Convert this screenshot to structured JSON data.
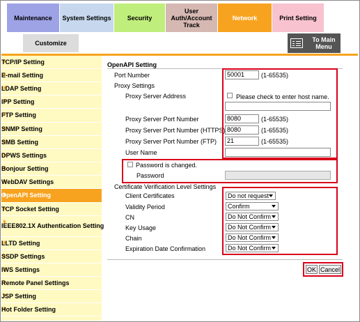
{
  "tabs": {
    "maintenance": "Maintenance",
    "system_settings": "System Settings",
    "security": "Security",
    "user_auth_line1": "User",
    "user_auth_line2": "Auth/Account",
    "user_auth_line3": "Track",
    "network": "Network",
    "print_setting": "Print Setting",
    "customize": "Customize",
    "to_main_line1": "To Main",
    "to_main_line2": "Menu"
  },
  "sidebar": {
    "items": [
      {
        "label": "TCP/IP Setting"
      },
      {
        "label": "E-mail Setting"
      },
      {
        "label": "LDAP Setting"
      },
      {
        "label": "IPP Setting"
      },
      {
        "label": "FTP Setting"
      },
      {
        "label": "SNMP Setting"
      },
      {
        "label": "SMB Setting"
      },
      {
        "label": "DPWS Settings"
      },
      {
        "label": "Bonjour Setting"
      },
      {
        "label": "WebDAV Settings"
      },
      {
        "label": "OpenAPI Setting"
      },
      {
        "label": "TCP Socket Setting"
      },
      {
        "label": "IEEE802.1X Authentication Setting"
      },
      {
        "label": "LLTD Setting"
      },
      {
        "label": "SSDP Settings"
      },
      {
        "label": "IWS Settings"
      },
      {
        "label": "Remote Panel Settings"
      },
      {
        "label": "JSP Setting"
      },
      {
        "label": "Hot Folder Setting"
      }
    ],
    "active": "OpenAPI Setting"
  },
  "form": {
    "title": "OpenAPI Setting",
    "port_number_label": "Port Number",
    "port_number_value": "50001",
    "port_number_range": "(1-65535)",
    "proxy_settings_label": "Proxy Settings",
    "proxy_address_label": "Proxy Server Address",
    "proxy_address_check_label": "Please check to enter host name.",
    "proxy_address_value": "",
    "proxy_port_label": "Proxy Server Port Number",
    "proxy_port_value": "8080",
    "proxy_port_range": "(1-65535)",
    "proxy_https_label": "Proxy Server Port Number (HTTPS)",
    "proxy_https_value": "8080",
    "proxy_https_range": "(1-65535)",
    "proxy_ftp_label": "Proxy Server Port Number (FTP)",
    "proxy_ftp_value": "21",
    "proxy_ftp_range": "(1-65535)",
    "user_name_label": "User Name",
    "user_name_value": "",
    "password_changed_label": "Password is changed.",
    "password_label": "Password",
    "cert_level_label": "Certificate Verification Level Settings",
    "client_cert_label": "Client Certificates",
    "client_cert_value": "Do not request",
    "validity_label": "Validity Period",
    "validity_value": "Confirm",
    "cn_label": "CN",
    "cn_value": "Do Not Confirm",
    "key_usage_label": "Key Usage",
    "key_usage_value": "Do Not Confirm",
    "chain_label": "Chain",
    "chain_value": "Do Not Confirm",
    "expiration_label": "Expiration Date Confirmation",
    "expiration_value": "Do Not Confirm"
  },
  "buttons": {
    "ok": "OK",
    "cancel": "Cancel"
  },
  "colors": {
    "network_tab": "#f7a31f",
    "sidebar_bg": "#fff9c2",
    "highlight_box": "#d9001b"
  }
}
